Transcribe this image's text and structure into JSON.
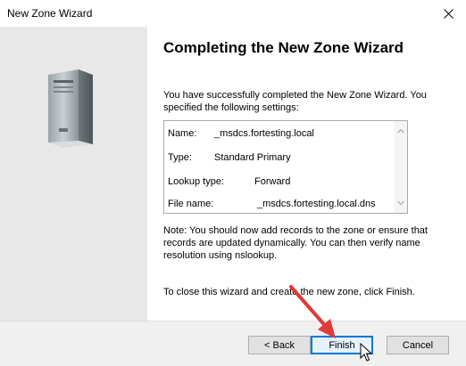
{
  "window": {
    "title": "New Zone Wizard"
  },
  "main": {
    "heading": "Completing the New Zone Wizard",
    "intro": "You have successfully completed the New Zone Wizard. You specified the following settings:",
    "settings": [
      {
        "label": "Name:",
        "value": "_msdcs.fortesting.local"
      },
      {
        "label": "Type:",
        "value": "Standard Primary"
      },
      {
        "label": "Lookup type:",
        "value": "Forward"
      },
      {
        "label": "File name:",
        "value": "_msdcs.fortesting.local.dns"
      }
    ],
    "note": "Note: You should now add records to the zone or ensure that records are updated dynamically. You can then verify name resolution using nslookup.",
    "finish_hint": "To close this wizard and create the new zone, click Finish."
  },
  "buttons": {
    "back": "< Back",
    "finish": "Finish",
    "cancel": "Cancel"
  },
  "icons": {
    "close": "close-icon",
    "server": "server-icon",
    "pointer_arrow": "red-arrow-annotation",
    "mouse_cursor": "mouse-cursor-icon"
  },
  "colors": {
    "left_panel": "#e8e8e8",
    "finish_focus": "#0078d7",
    "annotation_arrow": "#e03a3a"
  }
}
